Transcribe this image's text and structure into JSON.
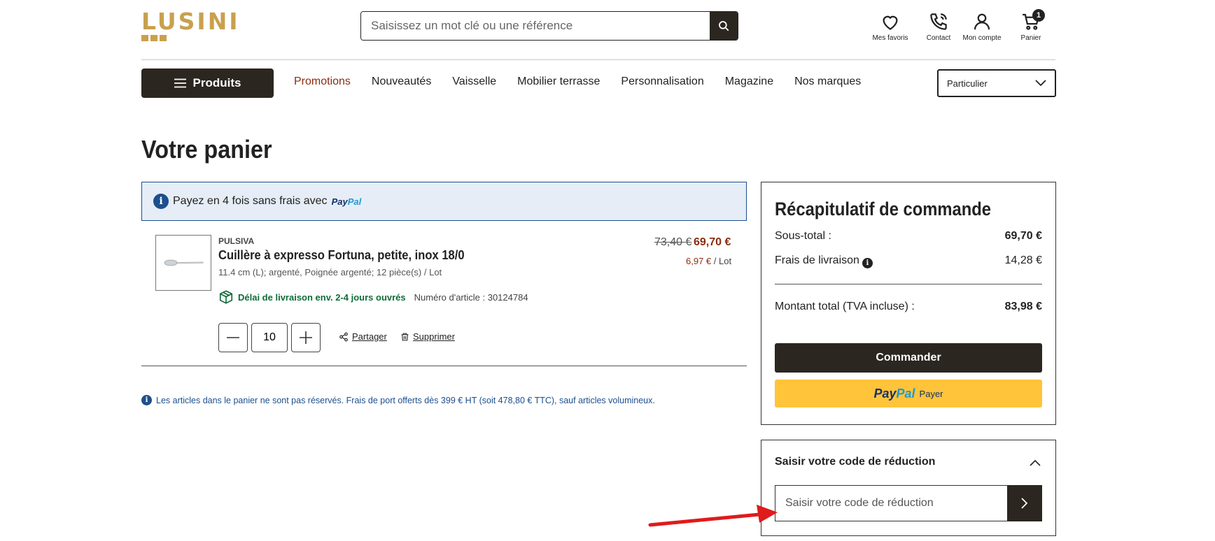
{
  "header": {
    "logo_text": "LUSINI",
    "search_placeholder": "Saisissez un mot clé ou une référence",
    "icons": [
      {
        "name": "heart-icon",
        "label": "Mes favoris"
      },
      {
        "name": "phone-icon",
        "label": "Contact"
      },
      {
        "name": "user-icon",
        "label": "Mon compte"
      },
      {
        "name": "cart-icon",
        "label": "Panier"
      }
    ],
    "cart_count": "1"
  },
  "nav": {
    "produits_label": "Produits",
    "items": [
      "Promotions",
      "Nouveautés",
      "Vaisselle",
      "Mobilier terrasse",
      "Personnalisation",
      "Magazine",
      "Nos marques"
    ],
    "customer_type": "Particulier"
  },
  "page_title": "Votre panier",
  "paypal_banner": {
    "text": "Payez en 4 fois sans frais avec",
    "logo_part1": "Pay",
    "logo_part2": "Pal"
  },
  "product": {
    "brand": "PULSIVA",
    "name": "Cuillère à expresso Fortuna, petite, inox 18/0",
    "description": "11.4 cm (L); argenté, Poignée argenté; 12 pièce(s) / Lot",
    "delivery": "Délai de livraison env. 2-4 jours ouvrés",
    "reference": "Numéro d'article : 30124784",
    "old_price": "73,40 €",
    "new_price": "69,70 €",
    "unit_price": "6,97 €",
    "unit_suffix": " / Lot",
    "quantity": "10",
    "share_label": "Partager",
    "delete_label": "Supprimer"
  },
  "note": "Les articles dans le panier ne sont pas réservés. Frais de port offerts dès 399 € HT (soit 478,80 € TTC), sauf articles volumineux.",
  "summary": {
    "title": "Récapitulatif de commande",
    "subtotal_label": "Sous-total :",
    "subtotal_value": "69,70 €",
    "shipping_label": "Frais de livraison",
    "shipping_value": "14,28 €",
    "total_label": "Montant total (TVA incluse) :",
    "total_value": "83,98 €",
    "order_button": "Commander",
    "paypal_pay": "Payer"
  },
  "discount": {
    "title": "Saisir votre code de réduction",
    "placeholder": "Saisir votre code de réduction"
  },
  "colors": {
    "dark": "#2b2620",
    "gold": "#c9a04e",
    "promo": "#8b2c0f",
    "info_blue": "#1d4f8c",
    "green": "#0f6b3a",
    "paypal_yellow": "#ffc439",
    "arrow_red": "#e01b1b"
  }
}
